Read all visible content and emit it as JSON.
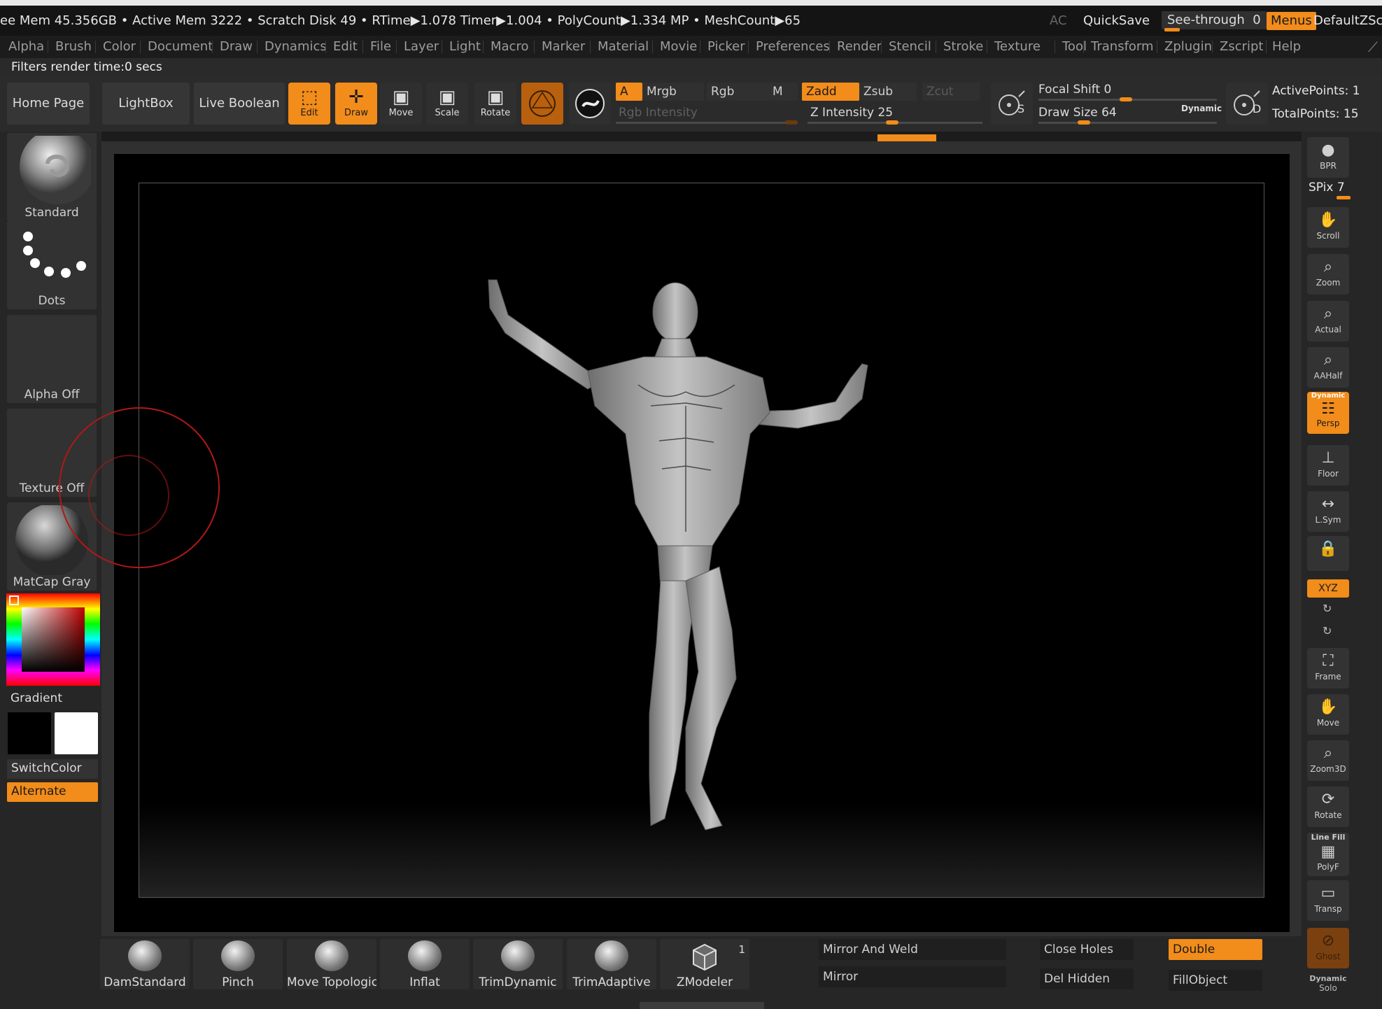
{
  "status": {
    "stats": "ee Mem 45.356GB • Active Mem 3222 • Scratch Disk 49 •  RTime▶1.078 Timer▶1.004 • PolyCount▶1.334 MP  • MeshCount▶65",
    "ac": "AC",
    "quicksave": "QuickSave",
    "see_through_label": "See-through",
    "see_through_value": "0",
    "menus": "Menus",
    "default_zscript": "DefaultZScript"
  },
  "menu": [
    "Alpha",
    "Brush",
    "Color",
    "Document",
    "Draw",
    "Dynamics",
    "Edit",
    "File",
    "Layer",
    "Light",
    "Macro",
    "Marker",
    "Material",
    "Movie",
    "Picker",
    "Preferences",
    "Render",
    "Stencil",
    "Stroke",
    "Texture",
    "Tool",
    "Transform",
    "Zplugin",
    "Zscript",
    "Help"
  ],
  "filters": "Filters render time:0 secs",
  "toolbar": {
    "home_page": "Home Page",
    "lightbox": "LightBox",
    "live_boolean": "Live Boolean",
    "edit": "Edit",
    "draw": "Draw",
    "move": "Move",
    "scale": "Scale",
    "rotate": "Rotate",
    "a": "A",
    "mrgb": "Mrgb",
    "rgb": "Rgb",
    "m": "M",
    "zadd": "Zadd",
    "zsub": "Zsub",
    "zcut": "Zcut",
    "rgb_intensity": "Rgb Intensity",
    "z_intensity": "Z Intensity 25",
    "focal_shift": "Focal Shift 0",
    "draw_size": "Draw Size 64",
    "dynamic": "Dynamic",
    "active_points": "ActivePoints: 1",
    "total_points": "TotalPoints: 15",
    "s_letter": "S",
    "d_letter": "D"
  },
  "left": {
    "standard": "Standard",
    "dots": "Dots",
    "alpha_off": "Alpha Off",
    "texture_off": "Texture Off",
    "matcap": "MatCap Gray",
    "gradient": "Gradient",
    "switchcolor": "SwitchColor",
    "alternate": "Alternate"
  },
  "right": {
    "bpr": "BPR",
    "spix": "SPix 7",
    "scroll": "Scroll",
    "zoom": "Zoom",
    "actual": "Actual",
    "aahalf": "AAHalf",
    "dynamic": "Dynamic",
    "persp": "Persp",
    "floor": "Floor",
    "lsym": "L.Sym",
    "xyz": "XYZ",
    "frame": "Frame",
    "move": "Move",
    "zoom3d": "Zoom3D",
    "rotate": "Rotate",
    "linefill": "Line Fill",
    "polyf": "PolyF",
    "transp": "Transp",
    "ghost": "Ghost",
    "solo_dynamic": "Dynamic",
    "solo": "Solo"
  },
  "bottom": {
    "brushes": [
      "DamStandard",
      "Pinch",
      "Move Topologica",
      "Inflat",
      "TrimDynamic",
      "TrimAdaptive",
      "ZModeler"
    ],
    "zmodeler_count": "1",
    "mirror_and_weld": "Mirror And Weld",
    "mirror": "Mirror",
    "close_holes": "Close Holes",
    "del_hidden": "Del Hidden",
    "double": "Double",
    "fillobject": "FillObject"
  },
  "colors": {
    "accent": "#f28c1a",
    "background": "#2a2a2a",
    "viewport": "#000000",
    "cursor_ring": "#b01818"
  }
}
